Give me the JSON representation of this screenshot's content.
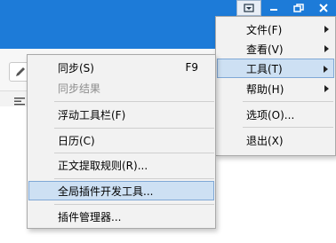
{
  "window": {
    "controls": [
      {
        "name": "menu-toggle-button",
        "icon": "dropdown-icon",
        "pressed": true
      },
      {
        "name": "minimize-button",
        "icon": "minimize-icon",
        "pressed": false
      },
      {
        "name": "restore-button",
        "icon": "restore-icon",
        "pressed": false
      },
      {
        "name": "close-button",
        "icon": "close-icon",
        "pressed": false
      }
    ],
    "accent": "#1d7bd8"
  },
  "main_menu": {
    "items": [
      {
        "label": "文件(F)",
        "submenu": true
      },
      {
        "label": "查看(V)",
        "submenu": true
      },
      {
        "label": "工具(T)",
        "submenu": true,
        "highlighted": true
      },
      {
        "label": "帮助(H)",
        "submenu": true
      },
      {
        "label": "选项(O)...",
        "submenu": false
      },
      {
        "label": "退出(X)",
        "submenu": false
      }
    ]
  },
  "tools_submenu": {
    "items": [
      {
        "label": "同步(S)",
        "shortcut": "F9",
        "disabled": false
      },
      {
        "label": "同步结果",
        "disabled": true
      },
      {
        "label": "浮动工具栏(F)",
        "disabled": false
      },
      {
        "label": "日历(C)",
        "disabled": false
      },
      {
        "label": "正文提取规则(R)...",
        "disabled": false
      },
      {
        "label": "全局插件开发工具...",
        "disabled": false,
        "highlighted": true
      },
      {
        "label": "插件管理器...",
        "disabled": false
      }
    ]
  }
}
